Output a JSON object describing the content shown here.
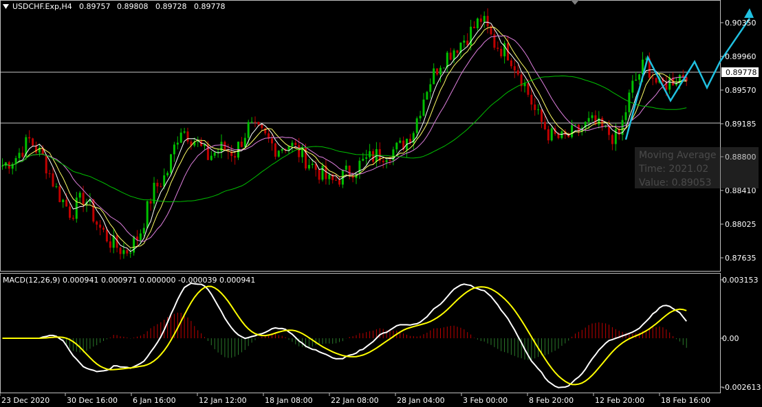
{
  "header": {
    "symbol": "USDCHF.Exp,H4",
    "open": "0.89757",
    "high": "0.89808",
    "low": "0.89728",
    "close": "0.89778"
  },
  "price_axis": {
    "ticks": [
      "0.90350",
      "0.89960",
      "0.89570",
      "0.89185",
      "0.88800",
      "0.88410",
      "0.88025",
      "0.87635"
    ],
    "current_price_label": "0.89778"
  },
  "macd_panel": {
    "label": "MACD(12,26,9) 0.000941 0.000971 0.000000 -0.000039 0.000941",
    "ticks": [
      "0.003153",
      "0.00",
      "-0.002613"
    ]
  },
  "time_axis": {
    "labels": [
      "23 Dec 2020",
      "30 Dec 16:00",
      "6 Jan 16:00",
      "12 Jan 12:00",
      "18 Jan 08:00",
      "22 Jan 08:00",
      "28 Jan 04:00",
      "3 Feb 00:00",
      "8 Feb 20:00",
      "12 Feb 20:00",
      "18 Feb 16:00"
    ]
  },
  "tooltip": {
    "line1": "Moving Average",
    "line2": "Time: 2021.02",
    "line3": "Value: 0.89053"
  },
  "colors": {
    "background": "#000000",
    "bull_candle": "#00c000",
    "bear_candle": "#c00000",
    "ma_fast": "#ffffff",
    "ma_mid": "#ffff66",
    "ma_slow": "#e080e0",
    "ma_long": "#00c000",
    "forecast": "#20c0e0",
    "macd_line": "#ffffff",
    "signal_line": "#ffff00",
    "hist_pos": "#c00000",
    "hist_neg": "#2a7a2a",
    "grid_line": "#c0c0c0"
  },
  "chart_data": {
    "type": "candlestick",
    "symbol": "USDCHF",
    "timeframe": "H4",
    "ylim": [
      0.8756,
      0.905
    ],
    "horizontal_levels": [
      0.89778,
      0.8919
    ],
    "price_path": [
      [
        "23 Dec 2020",
        0.887
      ],
      [
        "",
        0.888
      ],
      [
        "",
        0.89
      ],
      [
        "",
        0.8878
      ],
      [
        "",
        0.884
      ],
      [
        "30 Dec 16:00",
        0.8815
      ],
      [
        "",
        0.8835
      ],
      [
        "",
        0.88
      ],
      [
        "",
        0.878
      ],
      [
        "",
        0.877
      ],
      [
        "6 Jan 16:00",
        0.879
      ],
      [
        "",
        0.884
      ],
      [
        "",
        0.886
      ],
      [
        "",
        0.8915
      ],
      [
        "",
        0.89
      ],
      [
        "12 Jan 12:00",
        0.888
      ],
      [
        "",
        0.889
      ],
      [
        "",
        0.8885
      ],
      [
        "",
        0.8915
      ],
      [
        "",
        0.8905
      ],
      [
        "18 Jan 08:00",
        0.889
      ],
      [
        "",
        0.8895
      ],
      [
        "",
        0.888
      ],
      [
        "",
        0.8865
      ],
      [
        "",
        0.885
      ],
      [
        "22 Jan 08:00",
        0.886
      ],
      [
        "",
        0.887
      ],
      [
        "",
        0.888
      ],
      [
        "",
        0.8885
      ],
      [
        "",
        0.889
      ],
      [
        "28 Jan 04:00",
        0.891
      ],
      [
        "",
        0.896
      ],
      [
        "",
        0.899
      ],
      [
        "",
        0.9005
      ],
      [
        "",
        0.902
      ],
      [
        "3 Feb 00:00",
        0.904
      ],
      [
        "",
        0.901
      ],
      [
        "",
        0.9
      ],
      [
        "",
        0.897
      ],
      [
        "",
        0.893
      ],
      [
        "8 Feb 20:00",
        0.8905
      ],
      [
        "",
        0.89
      ],
      [
        "",
        0.891
      ],
      [
        "",
        0.892
      ],
      [
        "",
        0.891
      ],
      [
        "12 Feb 20:00",
        0.89
      ],
      [
        "",
        0.896
      ],
      [
        "",
        0.899
      ],
      [
        "",
        0.896
      ],
      [
        "",
        0.897
      ],
      [
        "18 Feb 16:00",
        0.8978
      ]
    ],
    "forecast_path": [
      0.89,
      0.8995,
      0.8945,
      0.899,
      0.896,
      0.899,
      0.904
    ]
  }
}
